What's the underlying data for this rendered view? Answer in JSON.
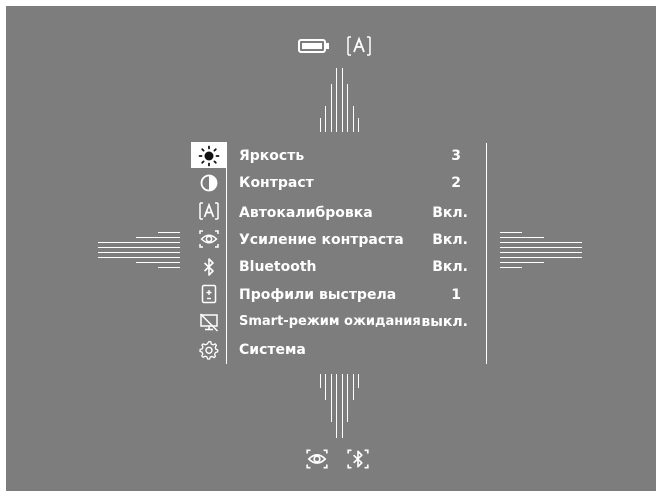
{
  "top_status": {
    "battery_icon": "battery-full-icon",
    "mode_icon": "auto-calibration-A-icon",
    "mode_glyph": "[A]"
  },
  "bottom_status": {
    "icons": [
      "contrast-eye-icon",
      "bluetooth-icon"
    ]
  },
  "menu": {
    "items": [
      {
        "icon": "brightness-sun-icon",
        "label": "Яркость",
        "value": "3",
        "selected": true
      },
      {
        "icon": "contrast-half-circle-icon",
        "label": "Контраст",
        "value": "2"
      },
      {
        "icon": "auto-calibration-icon",
        "label": "Автокалибровка",
        "value": "Вкл."
      },
      {
        "icon": "contrast-boost-eye-icon",
        "label": "Усиление контраста",
        "value": "Вкл."
      },
      {
        "icon": "bluetooth-icon",
        "label": "Bluetooth",
        "value": "Вкл."
      },
      {
        "icon": "shooting-profile-icon",
        "label": "Профили выстрела",
        "value": "1"
      },
      {
        "icon": "smart-standby-icon",
        "label": "Smart-режим ожидания",
        "value": "выкл."
      },
      {
        "icon": "gear-icon",
        "label": "Система",
        "value": ""
      }
    ]
  },
  "colors": {
    "background": "#7d7d7d",
    "foreground": "#ffffff"
  }
}
